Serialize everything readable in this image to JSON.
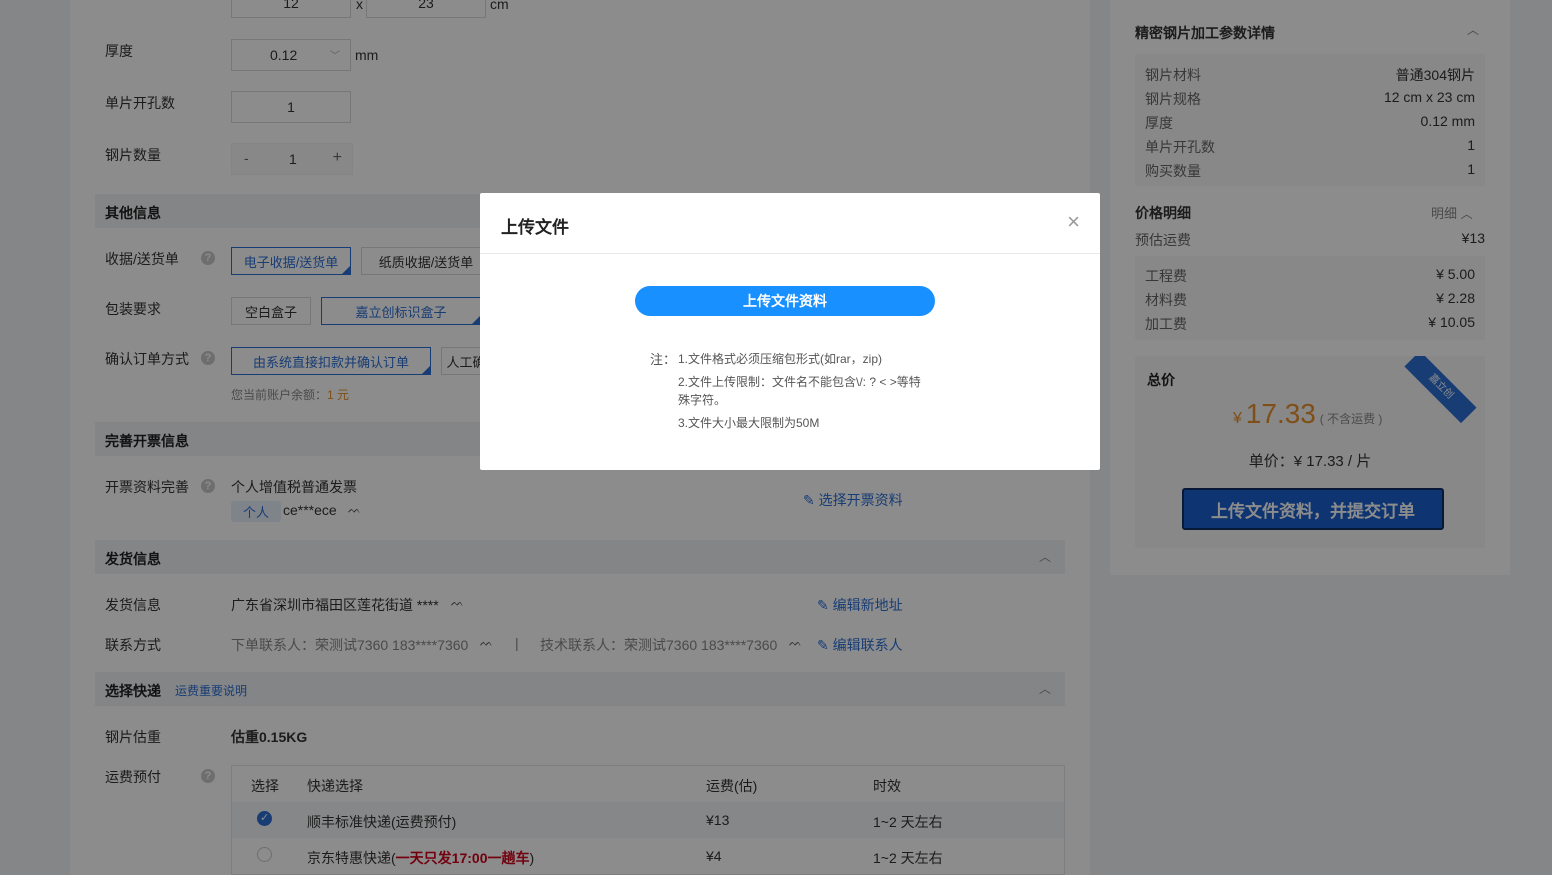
{
  "form": {
    "size_x": "12",
    "size_sep": "x",
    "size_y": "23",
    "size_unit": "cm",
    "thickness_label": "厚度",
    "thickness_value": "0.12",
    "thickness_unit": "mm",
    "holes_label": "单片开孔数",
    "holes_value": "1",
    "qty_label": "钢片数量",
    "qty_minus": "-",
    "qty_value": "1",
    "qty_plus": "+"
  },
  "other_info": {
    "title": "其他信息",
    "receipt_label": "收据/送货单",
    "receipt_options": [
      "电子收据/送货单",
      "纸质收据/送货单"
    ],
    "package_label": "包装要求",
    "package_options": [
      "空白盒子",
      "嘉立创标识盒子"
    ],
    "confirm_label": "确认订单方式",
    "confirm_options": [
      "由系统直接扣款并确认订单",
      "人工确"
    ],
    "balance_prefix": "您当前账户余额：",
    "balance_value": "1 元"
  },
  "invoice": {
    "title": "完善开票信息",
    "label": "开票资料完善",
    "type": "个人增值税普通发票",
    "tag": "个人",
    "name": "ce***ece",
    "select_link": "选择开票资料"
  },
  "shipping": {
    "title": "发货信息",
    "address_label": "发货信息",
    "address": "广东省深圳市福田区莲花街道 ****",
    "edit_address": "编辑新地址",
    "contact_label": "联系方式",
    "order_contact": "下单联系人：荣测试7360 183****7360",
    "separator": "|",
    "tech_contact": "技术联系人：荣测试7360 183****7360",
    "edit_contact": "编辑联系人"
  },
  "express": {
    "title": "选择快递",
    "note_link": "运费重要说明",
    "weight_label": "钢片估重",
    "weight_value": "估重0.15KG",
    "freight_label": "运费预付",
    "columns": [
      "选择",
      "快递选择",
      "运费(估)",
      "时效"
    ],
    "rows": [
      {
        "name": "顺丰标准快递(运费预付)",
        "name_extra": "",
        "name_end": "",
        "price": "¥13",
        "time": "1~2 天左右",
        "selected": true
      },
      {
        "name": "京东特惠快递(",
        "name_extra": "一天只发17:00一趟车",
        "name_end": ")",
        "price": "¥4",
        "time": "1~2 天左右",
        "selected": false
      }
    ]
  },
  "sidebar": {
    "detail_title": "精密钢片加工参数详情",
    "details": [
      {
        "k": "钢片材料",
        "v": "普通304钢片"
      },
      {
        "k": "钢片规格",
        "v": "12 cm x 23 cm"
      },
      {
        "k": "厚度",
        "v": "0.12 mm"
      },
      {
        "k": "单片开孔数",
        "v": "1"
      },
      {
        "k": "购买数量",
        "v": "1"
      }
    ],
    "price_title": "价格明细",
    "price_toggle": "明细",
    "freight_k": "预估运费",
    "freight_v": "¥13",
    "fees": [
      {
        "k": "工程费",
        "v": "¥ 5.00"
      },
      {
        "k": "材料费",
        "v": "¥ 2.28"
      },
      {
        "k": "加工费",
        "v": "¥ 10.05"
      }
    ],
    "total_label": "总价",
    "total_currency": "¥",
    "total_value": "17.33",
    "total_note": "( 不含运费 )",
    "ribbon": "嘉立创",
    "unit_price": "单价：¥ 17.33 / 片",
    "submit": "上传文件资料，并提交订单"
  },
  "modal": {
    "title": "上传文件",
    "close": "×",
    "upload_button": "上传文件资料",
    "note_prefix": "注：",
    "notes": [
      "1.文件格式必须压缩包形式(如rar，zip)",
      "2.文件上传限制：文件名不能包含\\/: ? < >等特",
      "殊字符。",
      "3.文件大小最大限制为50M"
    ]
  },
  "colors": {
    "accent": "#2c6fd6",
    "upload_blue": "#1890ff",
    "price_orange": "#e8912c",
    "warn_red": "#d0021b",
    "submit_bg": "#1a5fd0"
  }
}
